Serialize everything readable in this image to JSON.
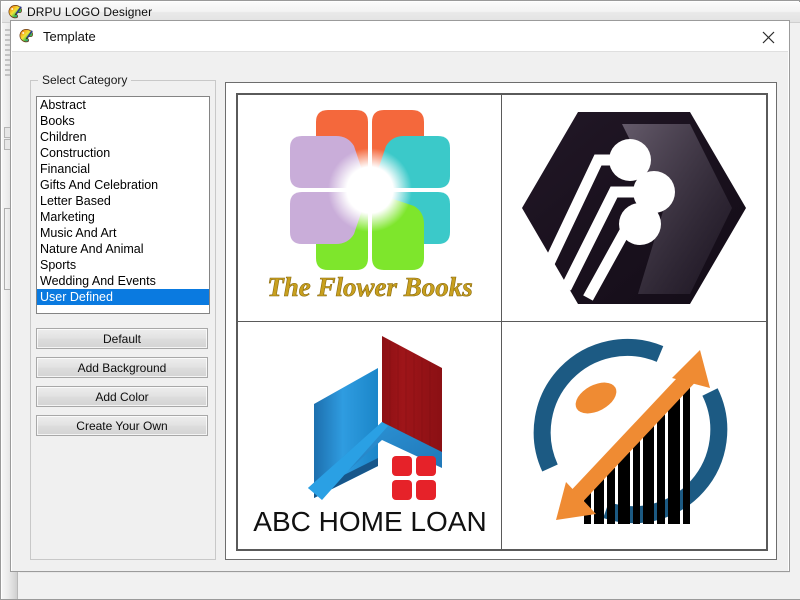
{
  "background_window": {
    "title": "DRPU LOGO Designer",
    "icon": "palette-brush-icon"
  },
  "dialog": {
    "title": "Template",
    "icon": "palette-brush-icon",
    "close_label": "×"
  },
  "sidebar": {
    "groupbox_legend": "Select Category",
    "categories": [
      {
        "label": "Abstract",
        "selected": false
      },
      {
        "label": "Books",
        "selected": false
      },
      {
        "label": "Children",
        "selected": false
      },
      {
        "label": "Construction",
        "selected": false
      },
      {
        "label": "Financial",
        "selected": false
      },
      {
        "label": "Gifts And Celebration",
        "selected": false
      },
      {
        "label": "Letter Based",
        "selected": false
      },
      {
        "label": "Marketing",
        "selected": false
      },
      {
        "label": "Music And Art",
        "selected": false
      },
      {
        "label": "Nature And Animal",
        "selected": false
      },
      {
        "label": "Sports",
        "selected": false
      },
      {
        "label": "Wedding And Events",
        "selected": false
      },
      {
        "label": "User Defined",
        "selected": true
      }
    ],
    "buttons": [
      {
        "label": "Default"
      },
      {
        "label": "Add Background"
      },
      {
        "label": "Add Color"
      },
      {
        "label": "Create Your Own"
      }
    ]
  },
  "preview": {
    "templates": [
      {
        "name": "flower-books-logo",
        "caption": "The Flower Books",
        "caption_color": "#c8a01e",
        "colors": {
          "petal_orange": "#f4683c",
          "petal_teal": "#3bc9c9",
          "petal_green": "#7ee62c",
          "petal_purple": "#c9add9"
        }
      },
      {
        "name": "hexagon-circuit-logo",
        "caption": "",
        "colors": {
          "hex_dark": "#1d1321",
          "hex_light": "#4a4050",
          "trace": "#ffffff"
        }
      },
      {
        "name": "abc-home-loan-logo",
        "caption": "ABC HOME LOAN",
        "caption_color": "#111111",
        "colors": {
          "blue_light": "#2f9ce0",
          "blue_dark": "#1f6fae",
          "red_dark": "#a01418",
          "red_bright": "#e62229"
        }
      },
      {
        "name": "barchart-arrow-logo",
        "caption": "",
        "colors": {
          "circle_blue": "#1c5a83",
          "arrow_orange": "#ef8b33",
          "bars_black": "#000000"
        }
      }
    ]
  },
  "accent_colors": {
    "selection_blue": "#0a7ae0",
    "window_gray": "#f0f0f0",
    "border_gray": "#5a5a5a"
  }
}
